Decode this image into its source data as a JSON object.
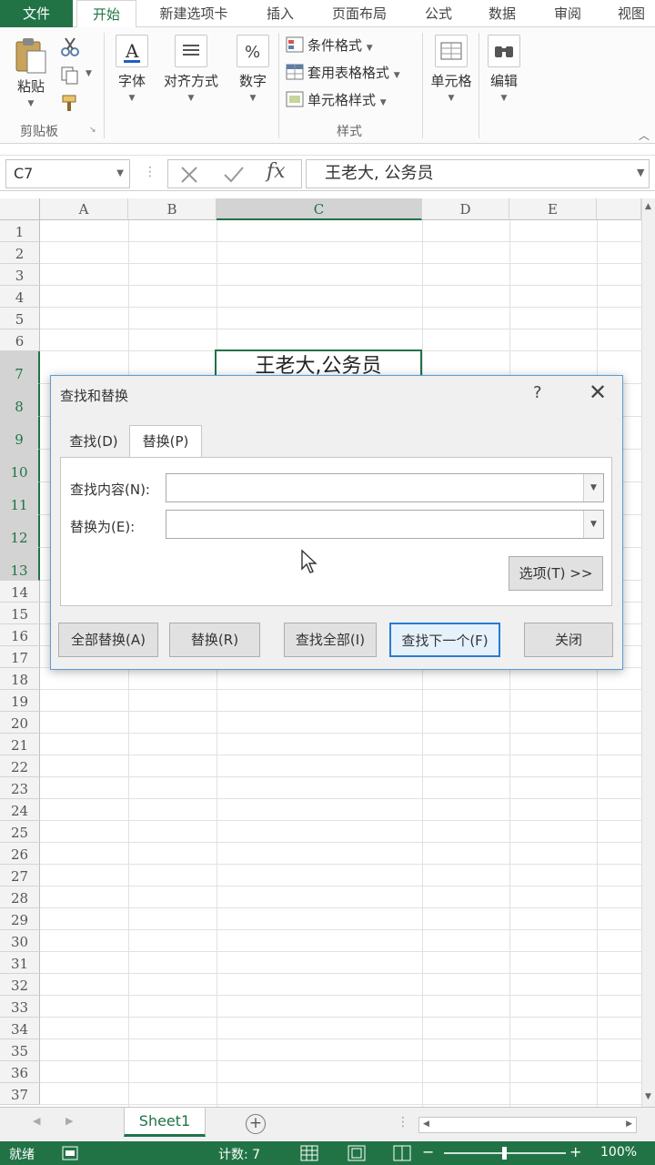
{
  "ribbon": {
    "tabs": [
      "文件",
      "开始",
      "新建选项卡",
      "插入",
      "页面布局",
      "公式",
      "数据",
      "审阅",
      "视图"
    ],
    "groups": {
      "clipboard_label": "剪贴板",
      "paste_label": "粘贴",
      "font_label": "字体",
      "align_label": "对齐方式",
      "number_label": "数字",
      "styles_label": "样式",
      "cond_format": "条件格式",
      "table_format": "套用表格格式",
      "cell_style": "单元格样式",
      "cells_label": "单元格",
      "edit_label": "编辑"
    }
  },
  "formula_bar": {
    "name_box": "C7",
    "content": "王老大, 公务员"
  },
  "grid": {
    "columns": [
      "A",
      "B",
      "C",
      "D",
      "E"
    ],
    "rows": [
      "1",
      "2",
      "3",
      "4",
      "5",
      "6",
      "7",
      "8",
      "9",
      "10",
      "11",
      "12",
      "13",
      "14",
      "15",
      "16",
      "17",
      "18",
      "19",
      "20",
      "21",
      "22",
      "23",
      "24",
      "25",
      "26",
      "27",
      "28",
      "29",
      "30",
      "31",
      "32",
      "33",
      "34",
      "35",
      "36",
      "37"
    ],
    "active_cell_value": "王老大,公务员"
  },
  "dialog": {
    "title": "查找和替换",
    "help": "?",
    "tabs": {
      "find": "查找(D)",
      "replace": "替换(P)"
    },
    "find_label": "查找内容(N):",
    "replace_label": "替换为(E):",
    "find_value": "",
    "replace_value": "",
    "options_button": "选项(T) >>",
    "buttons": {
      "replace_all": "全部替换(A)",
      "replace": "替换(R)",
      "find_all": "查找全部(I)",
      "find_next": "查找下一个(F)",
      "close": "关闭"
    }
  },
  "sheets": {
    "active": "Sheet1"
  },
  "status": {
    "ready": "就绪",
    "count_label": "计数: 7",
    "zoom": "100%"
  }
}
